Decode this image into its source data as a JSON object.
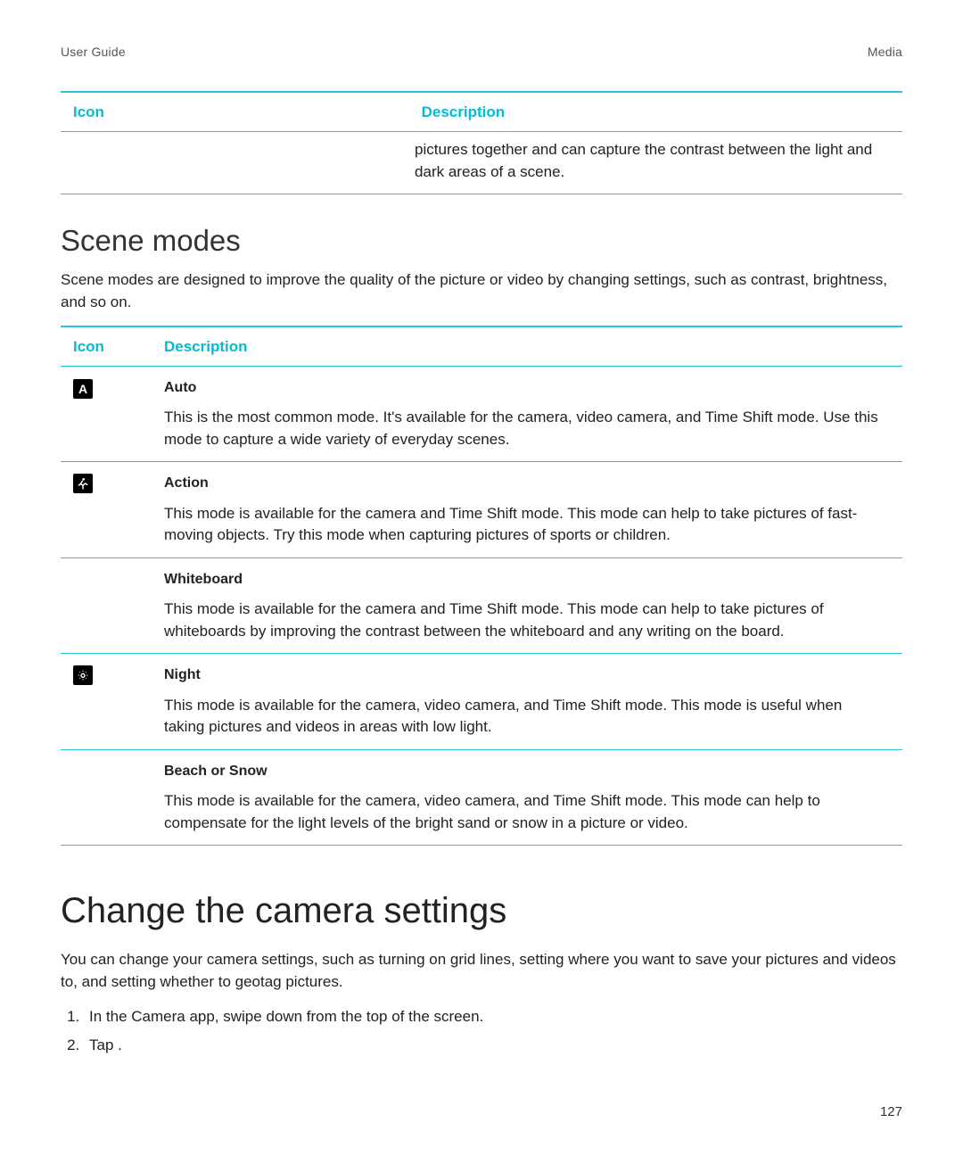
{
  "header": {
    "left": "User Guide",
    "right": "Media"
  },
  "table1": {
    "head_icon": "Icon",
    "head_desc": "Description",
    "row0_desc": "pictures together and can capture the contrast between the light and dark areas of a scene."
  },
  "scene": {
    "heading": "Scene modes",
    "lead": "Scene modes are designed to improve the quality of the picture or video by changing settings, such as contrast, brightness, and so on.",
    "head_icon": "Icon",
    "head_desc": "Description",
    "rows": {
      "r0": {
        "title": "Auto",
        "body": "This is the most common mode. It's available for the camera, video camera, and Time Shift mode. Use this mode to capture a wide variety of everyday scenes."
      },
      "r1": {
        "title": "Action",
        "body": "This mode is available for the camera and Time Shift mode. This mode can help to take pictures of fast-moving objects. Try this mode when capturing pictures of sports or children."
      },
      "r2": {
        "title": "Whiteboard",
        "body": "This mode is available for the camera and Time Shift mode. This mode can help to take pictures of whiteboards by improving the contrast between the whiteboard and any writing on the board."
      },
      "r3": {
        "title": "Night",
        "body": "This mode is available for the camera, video camera, and Time Shift mode. This mode is useful when taking pictures and videos in areas with low light."
      },
      "r4": {
        "title": "Beach or Snow",
        "body": "This mode is available for the camera, video camera, and Time Shift mode. This mode can help to compensate for the light levels of the bright sand or snow in a picture or video."
      }
    }
  },
  "settings": {
    "heading": "Change the camera settings",
    "lead": "You can change your camera settings, such as turning on grid lines, setting where you want to save your pictures and videos to, and setting whether to geotag pictures.",
    "step1": "In the Camera app, swipe down from the top of the screen.",
    "step2": "Tap      ."
  },
  "page_num": "127",
  "icons": {
    "auto_letter": "A"
  }
}
